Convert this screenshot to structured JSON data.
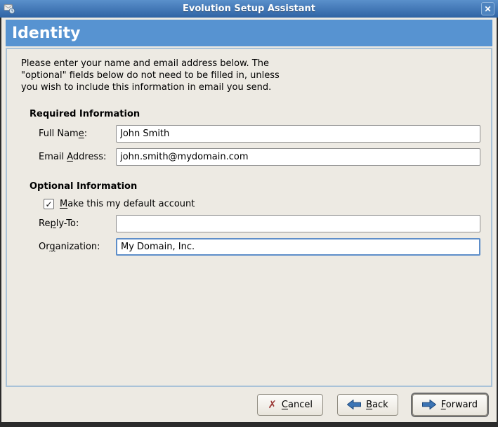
{
  "window": {
    "title": "Evolution Setup Assistant",
    "close_glyph": "✕"
  },
  "header": {
    "title": "Identity"
  },
  "intro": {
    "text": "Please enter your name and email address below. The\n\"optional\" fields below do not need to be filled in, unless\nyou wish to include this information in email you send."
  },
  "required": {
    "heading": "Required Information",
    "full_name": {
      "label_pre": "Full Nam",
      "label_mn": "e",
      "label_post": ":",
      "value": "John Smith"
    },
    "email": {
      "label_pre": "Email ",
      "label_mn": "A",
      "label_post": "ddress:",
      "value": "john.smith@mydomain.com"
    }
  },
  "optional": {
    "heading": "Optional Information",
    "default_account": {
      "label_mn": "M",
      "label_post": "ake this my default account",
      "checked": true,
      "mark": "✓"
    },
    "reply_to": {
      "label_pre": "Re",
      "label_mn": "p",
      "label_post": "ly-To:",
      "value": ""
    },
    "organization": {
      "label_pre": "Or",
      "label_mn": "g",
      "label_post": "anization:",
      "value": "My Domain, Inc."
    }
  },
  "buttons": {
    "cancel": {
      "icon": "✗",
      "label_mn": "C",
      "label_post": "ancel"
    },
    "back": {
      "label_mn": "B",
      "label_post": "ack"
    },
    "forward": {
      "label_mn": "F",
      "label_post": "orward"
    }
  },
  "colors": {
    "titlebar-top": "#5a90cb",
    "titlebar-bottom": "#2f63a4",
    "header-blue": "#5793d1",
    "window-bg": "#edeae3",
    "panel-border": "#a9c2d8",
    "focus-blue": "#5e8ec9",
    "frame-dark": "#2b2b2b",
    "button-border": "#918d82",
    "cancel-red": "#9c3a38",
    "arrow-blue": "#3c74b4"
  }
}
